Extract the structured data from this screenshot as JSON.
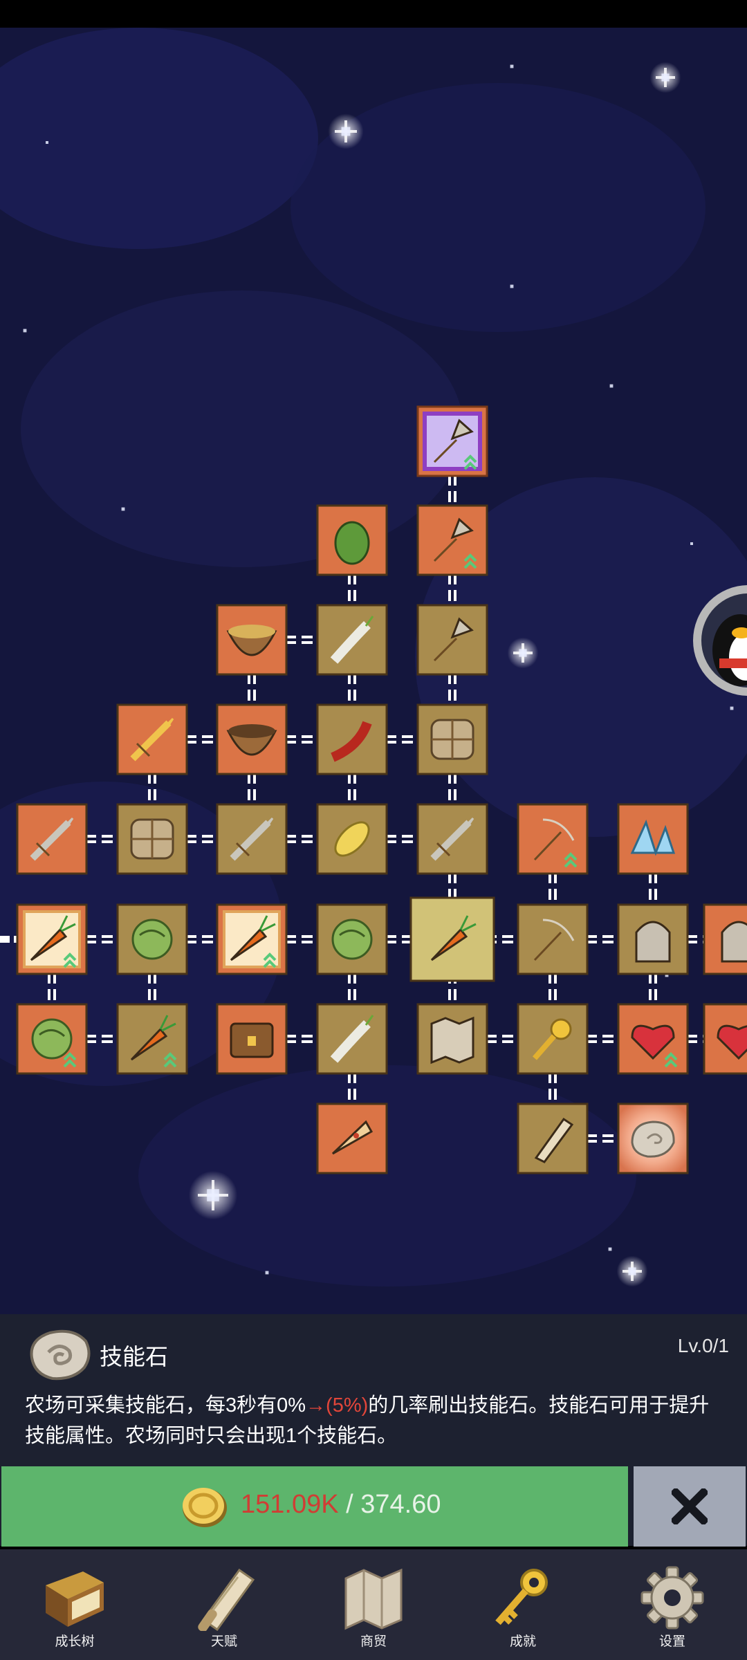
{
  "skill_tree": {
    "nodes": [
      {
        "id": "n1",
        "icon": "enchanted-shovel-icon",
        "tier": "purple"
      },
      {
        "id": "n2",
        "icon": "green-pepper-icon",
        "tier": "orange"
      },
      {
        "id": "n3",
        "icon": "shovel-upgrade-icon",
        "tier": "orange"
      },
      {
        "id": "n4",
        "icon": "soup-bowl-icon",
        "tier": "orange"
      },
      {
        "id": "n5",
        "icon": "radish-icon",
        "tier": "tan"
      },
      {
        "id": "n6",
        "icon": "shovel-icon",
        "tier": "tan"
      },
      {
        "id": "n7",
        "icon": "golden-sword-icon",
        "tier": "orange"
      },
      {
        "id": "n8",
        "icon": "bowl-icon",
        "tier": "orange"
      },
      {
        "id": "n9",
        "icon": "chili-pepper-icon",
        "tier": "tan"
      },
      {
        "id": "n10",
        "icon": "backpack-icon",
        "tier": "tan"
      },
      {
        "id": "n11",
        "icon": "iron-sword-icon",
        "tier": "orange"
      },
      {
        "id": "n12",
        "icon": "wooden-crate-icon",
        "tier": "tan"
      },
      {
        "id": "n13",
        "icon": "stone-sword-icon",
        "tier": "tan"
      },
      {
        "id": "n14",
        "icon": "corn-icon",
        "tier": "tan"
      },
      {
        "id": "n15",
        "icon": "wooden-sword-icon",
        "tier": "tan"
      },
      {
        "id": "n16",
        "icon": "pickaxe-upgrade-icon",
        "tier": "orange"
      },
      {
        "id": "n17",
        "icon": "crystal-icon",
        "tier": "orange"
      },
      {
        "id": "n18",
        "icon": "carrot-upgrade-icon",
        "tier": "orange"
      },
      {
        "id": "n19",
        "icon": "cabbage-icon",
        "tier": "tan"
      },
      {
        "id": "n20",
        "icon": "carrot-upgrade-icon",
        "tier": "orange"
      },
      {
        "id": "n21",
        "icon": "cabbage-icon",
        "tier": "tan"
      },
      {
        "id": "n22",
        "icon": "carrot-icon",
        "tier": "root"
      },
      {
        "id": "n23",
        "icon": "pickaxe-icon",
        "tier": "tan"
      },
      {
        "id": "n24",
        "icon": "tombstone-icon",
        "tier": "tan"
      },
      {
        "id": "n25",
        "icon": "tombstone-icon",
        "tier": "orange"
      },
      {
        "id": "n26",
        "icon": "cabbage-upgrade-icon",
        "tier": "orange"
      },
      {
        "id": "n27",
        "icon": "carrot-upgrade-icon",
        "tier": "tan"
      },
      {
        "id": "n28",
        "icon": "treasure-chest-icon",
        "tier": "orange"
      },
      {
        "id": "n29",
        "icon": "leek-icon",
        "tier": "tan"
      },
      {
        "id": "n30",
        "icon": "map-icon",
        "tier": "tan"
      },
      {
        "id": "n31",
        "icon": "golden-key-icon",
        "tier": "tan"
      },
      {
        "id": "n32",
        "icon": "heart-upgrade-icon",
        "tier": "orange"
      },
      {
        "id": "n33",
        "icon": "heart-icon",
        "tier": "orange"
      },
      {
        "id": "n34",
        "icon": "pizza-icon",
        "tier": "orange"
      },
      {
        "id": "n35",
        "icon": "scroll-icon",
        "tier": "tan"
      },
      {
        "id": "n36",
        "icon": "skill-stone-icon",
        "tier": "selected"
      }
    ]
  },
  "side_avatar": {
    "icon": "penguin-avatar-icon"
  },
  "detail_panel": {
    "icon": "skill-stone-icon",
    "title": "技能石",
    "level": "Lv.0/1",
    "desc_before": "农场可采集技能石，每3秒有0%",
    "desc_arrow": "→",
    "desc_chance": "(5%)",
    "desc_after": "的几率刷出技能石。技能石可用于提升技能属性。农场同时只会出现1个技能石。"
  },
  "upgrade_button": {
    "icon": "gold-coin-icon",
    "current": "151.09K",
    "separator": " / ",
    "cost": "374.60"
  },
  "close_button": {
    "icon": "close-x-icon"
  },
  "nav": {
    "items": [
      {
        "label": "成长树",
        "icon": "book-icon"
      },
      {
        "label": "天赋",
        "icon": "scroll-icon"
      },
      {
        "label": "商贸",
        "icon": "map-icon"
      },
      {
        "label": "成就",
        "icon": "key-icon"
      },
      {
        "label": "设置",
        "icon": "gear-icon"
      }
    ]
  },
  "colors": {
    "space_bg": "#14163d",
    "node_orange": "#db7446",
    "node_tan": "#a98c4e",
    "node_root": "#d1c277",
    "node_purple_border": "#8e3fc2",
    "buy_green": "#5db56c",
    "close_gray": "#a2a8b6",
    "panel_bg": "#1d2130",
    "nav_bg": "#262838",
    "price_red": "#d03d34"
  }
}
